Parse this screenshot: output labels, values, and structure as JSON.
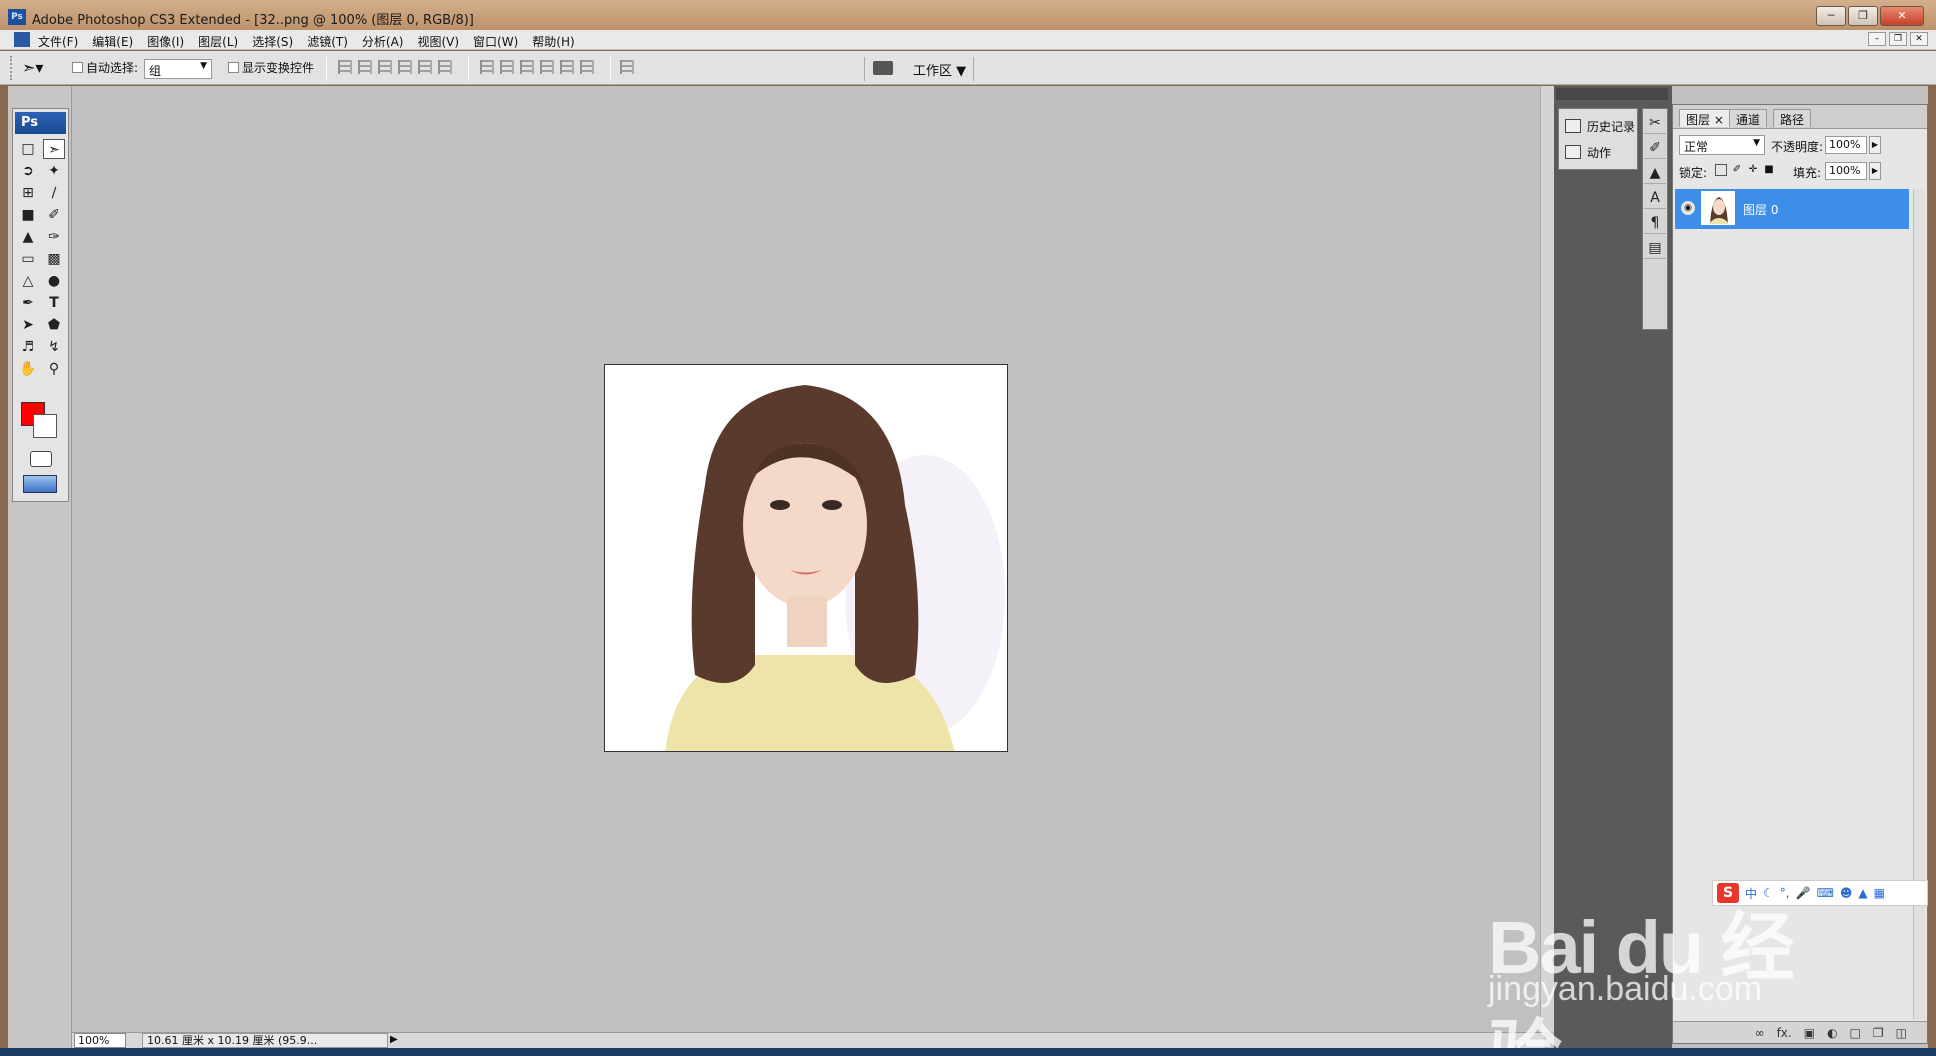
{
  "window": {
    "title": "Adobe Photoshop CS3 Extended - [32..png @ 100% (图层 0, RGB/8)]",
    "app_badge": "Ps"
  },
  "menu": {
    "items": [
      "文件(F)",
      "编辑(E)",
      "图像(I)",
      "图层(L)",
      "选择(S)",
      "滤镜(T)",
      "分析(A)",
      "视图(V)",
      "窗口(W)",
      "帮助(H)"
    ]
  },
  "options": {
    "auto_select_label": "自动选择:",
    "auto_select_value": "组",
    "show_transform_label": "显示变换控件",
    "workspace_label": "工作区"
  },
  "tools": {
    "logo": "Ps",
    "foreground_color": "#ff0000",
    "background_color": "#ffffff"
  },
  "status": {
    "zoom": "100%",
    "doc_info": "10.61 厘米 x 10.19 厘米 (95.9..."
  },
  "panels_collapsed": {
    "history": "历史记录",
    "actions": "动作"
  },
  "layers_panel": {
    "tabs": [
      "图层",
      "通道",
      "路径"
    ],
    "blend_mode": "正常",
    "opacity_label": "不透明度:",
    "opacity_value": "100%",
    "lock_label": "锁定:",
    "fill_label": "填充:",
    "fill_value": "100%",
    "layer_name": "图层 0",
    "footer_fx": "fx."
  },
  "ime": {
    "badge": "S",
    "mode": "中"
  },
  "watermark": {
    "brand": "Bai du 经验",
    "url": "jingyan.baidu.com"
  }
}
